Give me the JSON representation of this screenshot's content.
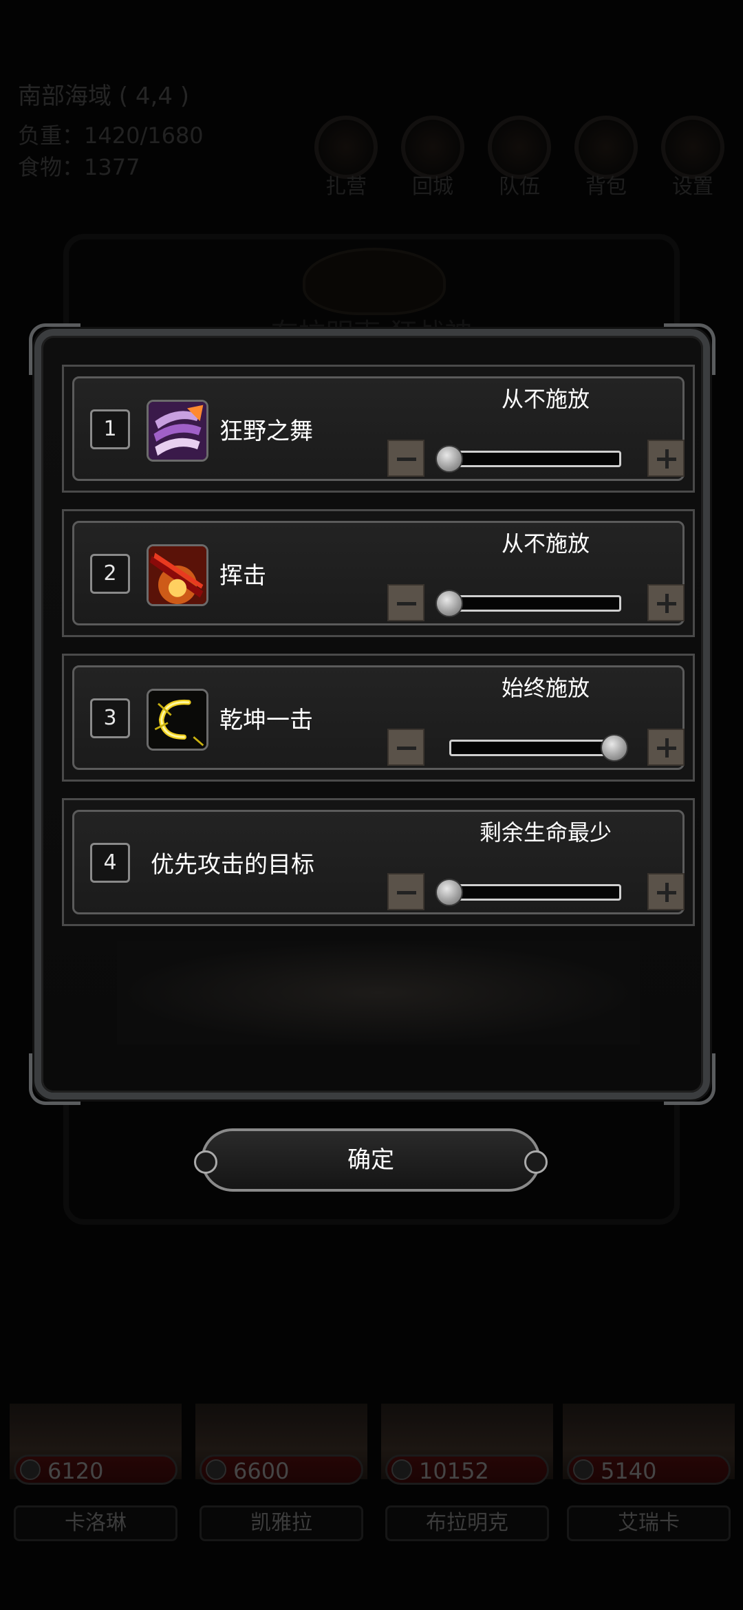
{
  "hud": {
    "location": "南部海域 ( 4,4 )",
    "load": "负重：1420/1680",
    "food": "食物：1377",
    "buttons": [
      {
        "label": "扎营",
        "icon": "camp-icon"
      },
      {
        "label": "回城",
        "icon": "return-icon"
      },
      {
        "label": "队伍",
        "icon": "team-icon"
      },
      {
        "label": "背包",
        "icon": "bag-icon"
      },
      {
        "label": "设置",
        "icon": "gear-icon"
      }
    ]
  },
  "background_title": "布拉明克 狂战神",
  "dialog": {
    "rows": [
      {
        "index": "1",
        "name": "狂野之舞",
        "icon": "wild-dance-skill-icon",
        "mode": "从不施放",
        "level": 0
      },
      {
        "index": "2",
        "name": "挥击",
        "icon": "swing-skill-icon",
        "mode": "从不施放",
        "level": 0
      },
      {
        "index": "3",
        "name": "乾坤一击",
        "icon": "cosmic-strike-skill-icon",
        "mode": "始终施放",
        "level": 1
      },
      {
        "index": "4",
        "name": "优先攻击的目标",
        "icon": null,
        "mode": "剩余生命最少",
        "level": 0
      }
    ],
    "confirm_label": "确定"
  },
  "party": [
    {
      "name": "卡洛琳",
      "hp": "6120"
    },
    {
      "name": "凯雅拉",
      "hp": "6600"
    },
    {
      "name": "布拉明克",
      "hp": "10152"
    },
    {
      "name": "艾瑞卡",
      "hp": "5140"
    }
  ],
  "colors": {
    "accent_hp_bar": "#2a0707",
    "stepper": "#5a5249",
    "frame": "#3b3d3f"
  }
}
